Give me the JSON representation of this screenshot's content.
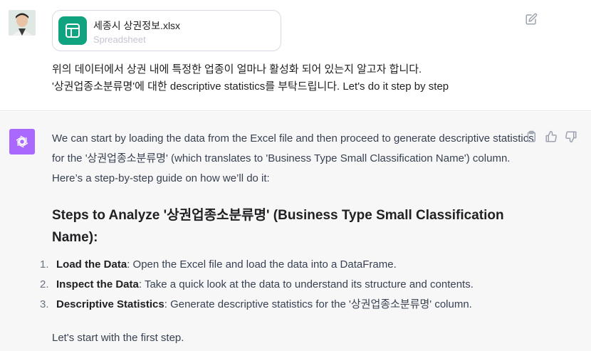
{
  "user": {
    "attachment": {
      "name": "세종시 상권정보.xlsx",
      "type": "Spreadsheet"
    },
    "message_line1": "위의 데이터에서 상권 내에 특정한 업종이 얼마나 활성화 되어 있는지 알고자 합니다.",
    "message_line2": "'상권업종소분류명'에 대한 descriptive statistics를 부탁드립니다. Let's do it step by step"
  },
  "assistant": {
    "intro": "We can start by loading the data from the Excel file and then proceed to generate descriptive statistics for the '상권업종소분류명' (which translates to 'Business Type Small Classification Name') column. Here’s a step-by-step guide on how we’ll do it:",
    "heading": "Steps to Analyze '상권업종소분류명' (Business Type Small Classification Name):",
    "steps": [
      {
        "num": "1.",
        "title": "Load the Data",
        "text": ": Open the Excel file and load the data into a DataFrame."
      },
      {
        "num": "2.",
        "title": "Inspect the Data",
        "text": ": Take a quick look at the data to understand its structure and contents."
      },
      {
        "num": "3.",
        "title": "Descriptive Statistics",
        "text": ": Generate descriptive statistics for the '상권업종소분류명' column."
      }
    ],
    "outro": "Let's start with the first step."
  },
  "icons": {
    "edit": "edit-icon",
    "copy": "clipboard-icon",
    "like": "thumbs-up-icon",
    "dislike": "thumbs-down-icon",
    "file": "spreadsheet-icon",
    "assistant_avatar": "openai-logo-icon"
  },
  "colors": {
    "accent_green": "#10a37f",
    "assistant_avatar": "#ab68ff",
    "assistant_bg": "#f7f7f8"
  }
}
